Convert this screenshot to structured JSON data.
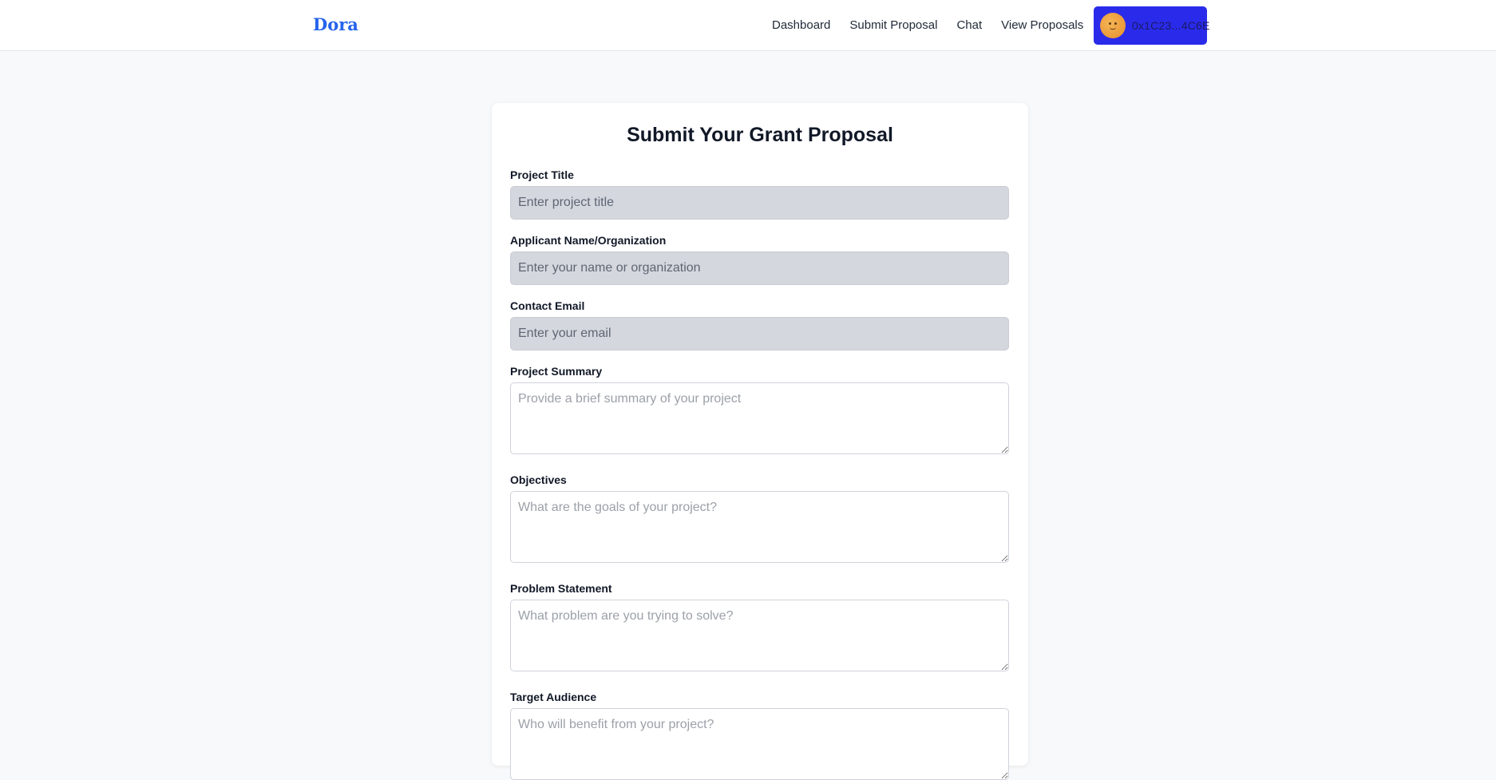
{
  "nav": {
    "brand": "Dora",
    "links": [
      "Dashboard",
      "Submit Proposal",
      "Chat",
      "View Proposals"
    ],
    "wallet_label": "0x1C23...4C6E",
    "wallet_color": "#2a2bea"
  },
  "form": {
    "title": "Submit Your Grant Proposal",
    "fields": [
      {
        "label": "Project Title",
        "placeholder": "Enter project title",
        "type": "input"
      },
      {
        "label": "Applicant Name/Organization",
        "placeholder": "Enter your name or organization",
        "type": "input"
      },
      {
        "label": "Contact Email",
        "placeholder": "Enter your email",
        "type": "input"
      },
      {
        "label": "Project Summary",
        "placeholder": "Provide a brief summary of your project",
        "type": "textarea"
      },
      {
        "label": "Objectives",
        "placeholder": "What are the goals of your project?",
        "type": "textarea"
      },
      {
        "label": "Problem Statement",
        "placeholder": "What problem are you trying to solve?",
        "type": "textarea"
      },
      {
        "label": "Target Audience",
        "placeholder": "Who will benefit from your project?",
        "type": "textarea"
      }
    ]
  }
}
